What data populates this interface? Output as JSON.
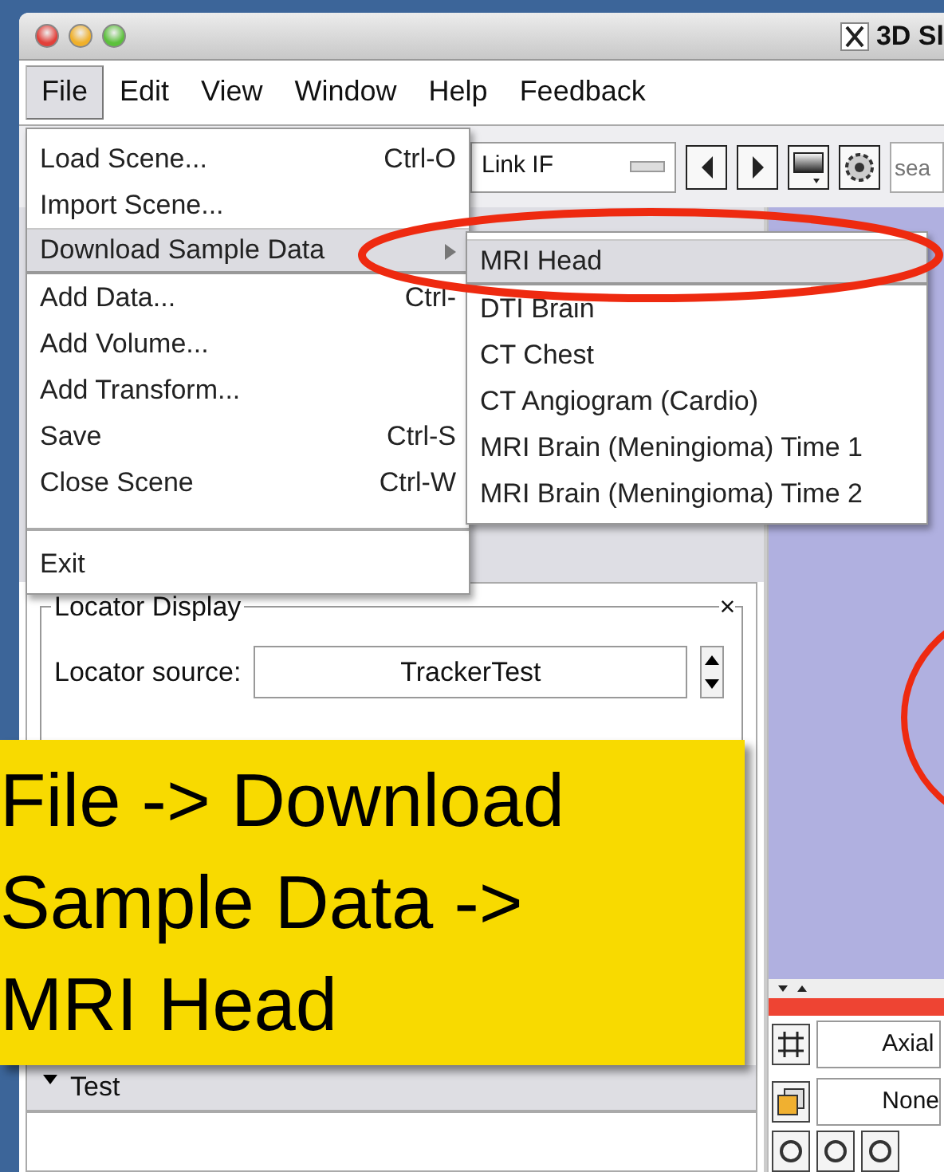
{
  "window": {
    "title": "3D Sl"
  },
  "menu_bar": [
    {
      "label": "File",
      "selected": true
    },
    {
      "label": "Edit",
      "selected": false
    },
    {
      "label": "View",
      "selected": false
    },
    {
      "label": "Window",
      "selected": false
    },
    {
      "label": "Help",
      "selected": false
    },
    {
      "label": "Feedback",
      "selected": false
    }
  ],
  "toolbar": {
    "link_combo": "Link IF",
    "search_placeholder": "sea"
  },
  "file_menu": [
    {
      "kind": "item",
      "label": "Load Scene...",
      "shortcut": "Ctrl-O",
      "selected": false
    },
    {
      "kind": "item",
      "label": "Import Scene...",
      "selected": false
    },
    {
      "kind": "submenu",
      "label": "Download Sample Data",
      "selected": true
    },
    {
      "kind": "item",
      "label": "Add Data...",
      "shortcut": "Ctrl-",
      "selected": false
    },
    {
      "kind": "item",
      "label": "Add Volume...",
      "selected": false
    },
    {
      "kind": "item",
      "label": "Add Transform...",
      "selected": false
    },
    {
      "kind": "item",
      "label": "Save",
      "shortcut": "Ctrl-S",
      "selected": false
    },
    {
      "kind": "item",
      "label": "Close Scene",
      "shortcut": "Ctrl-W",
      "selected": false
    },
    {
      "kind": "separator"
    },
    {
      "kind": "item",
      "label": "Exit",
      "selected": false
    }
  ],
  "sample_data_menu": [
    {
      "label": "MRI Head",
      "selected": true
    },
    {
      "label": "DTI Brain",
      "selected": false
    },
    {
      "label": "CT Chest",
      "selected": false
    },
    {
      "label": "CT Angiogram (Cardio)",
      "selected": false
    },
    {
      "label": "MRI Brain (Meningioma) Time 1",
      "selected": false
    },
    {
      "label": "MRI Brain (Meningioma) Time 2",
      "selected": false
    }
  ],
  "locator_display": {
    "title": "Locator Display",
    "close": "×",
    "source_label": "Locator source:",
    "source_value": "TrackerTest"
  },
  "section": {
    "label": "Test",
    "expanded": true
  },
  "slice_controls": {
    "orientation": "Axial",
    "layer": "None"
  },
  "annotation": {
    "lines": [
      "File ->  Download",
      "Sample Data ->",
      "MRI Head"
    ]
  }
}
